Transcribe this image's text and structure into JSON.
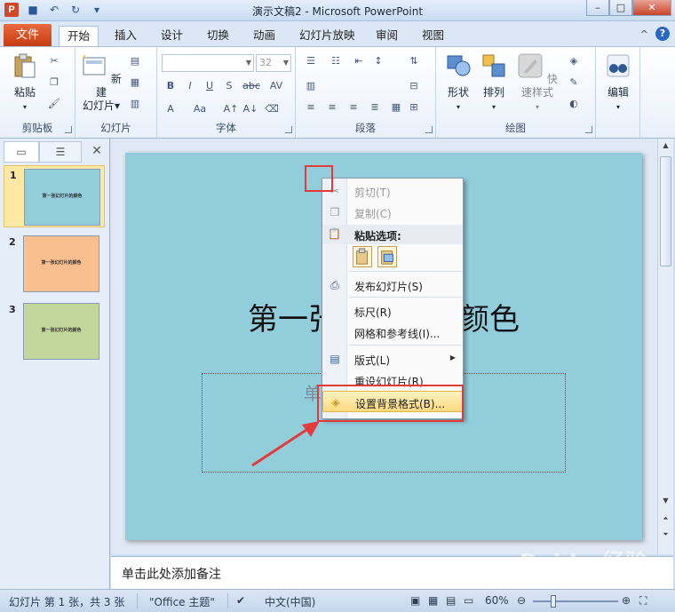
{
  "titlebar": {
    "app_icon": "P",
    "title": "演示文稿2 - Microsoft PowerPoint",
    "qat": [
      "save-icon",
      "undo-icon",
      "redo-icon",
      "customize-icon"
    ]
  },
  "tabs": {
    "file": "文件",
    "items": [
      "开始",
      "插入",
      "设计",
      "切换",
      "动画",
      "幻灯片放映",
      "审阅",
      "视图"
    ],
    "active": "开始",
    "help": "?",
    "collapse": "^"
  },
  "ribbon": {
    "clipboard": {
      "label": "剪贴板",
      "paste": "粘贴"
    },
    "slides": {
      "label": "幻灯片",
      "new_slide_line1": "新建",
      "new_slide_line2": "幻灯片"
    },
    "font": {
      "label": "字体",
      "font_name": "",
      "font_size": "32",
      "bold": "B",
      "italic": "I",
      "underline": "U",
      "shadow": "S",
      "strike": "abc",
      "spacing": "AV",
      "grow": "A",
      "case": "Aa"
    },
    "paragraph": {
      "label": "段落"
    },
    "drawing": {
      "label": "绘图",
      "shapes": "形状",
      "arrange": "排列",
      "quick_styles": "快速样式"
    },
    "editing": {
      "label": "编辑"
    }
  },
  "slides_panel": {
    "thumbs": [
      {
        "num": "1",
        "color": "#92cddc",
        "title": "第一张幻灯片的颜色"
      },
      {
        "num": "2",
        "color": "#fabf8f",
        "title": "第一张幻灯片的颜色"
      },
      {
        "num": "3",
        "color": "#c3d69b",
        "title": "第一张幻灯片的颜色"
      }
    ]
  },
  "slide": {
    "title": "第一张幻灯片的颜色",
    "subtitle_placeholder": "单击此处添加副标题",
    "background": "#92cddc"
  },
  "context_menu": {
    "cut": "剪切(T)",
    "copy": "复制(C)",
    "paste_header": "粘贴选项:",
    "publish": "发布幻灯片(S)",
    "ruler": "标尺(R)",
    "grid": "网格和参考线(I)...",
    "layout": "版式(L)",
    "reset": "重设幻灯片(R)",
    "format_bg": "设置背景格式(B)..."
  },
  "notes": {
    "placeholder": "单击此处添加备注"
  },
  "statusbar": {
    "slide_info": "幻灯片 第 1 张，共 3 张",
    "theme": "\"Office 主题\"",
    "language": "中文(中国)",
    "zoom": "60%"
  },
  "watermark": "Baidu 经验"
}
